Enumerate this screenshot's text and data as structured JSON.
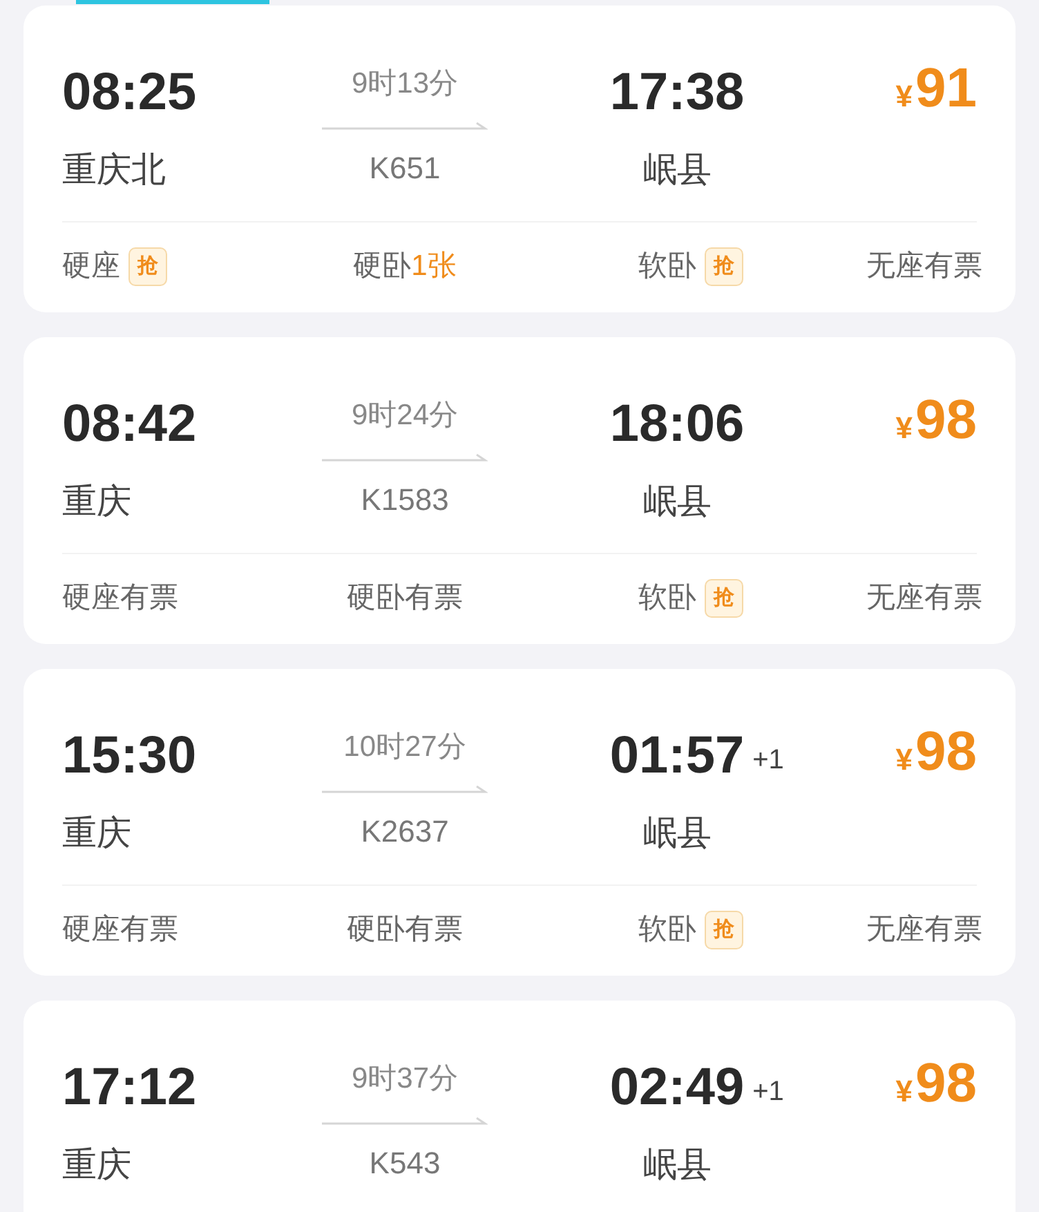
{
  "trains": [
    {
      "depart_time": "08:25",
      "depart_station": "重庆北",
      "duration": "9时13分",
      "train_no": "K651",
      "arrive_time": "17:38",
      "arrive_station": "岷县",
      "currency": "¥",
      "price": "91",
      "seats": [
        {
          "label": "硬座",
          "badge": "抢"
        },
        {
          "label": "硬卧",
          "status": "1张",
          "highlight": true
        },
        {
          "label": "软卧",
          "badge": "抢"
        },
        {
          "label": "无座",
          "status": "有票",
          "highlight": false
        }
      ]
    },
    {
      "depart_time": "08:42",
      "depart_station": "重庆",
      "duration": "9时24分",
      "train_no": "K1583",
      "arrive_time": "18:06",
      "arrive_station": "岷县",
      "currency": "¥",
      "price": "98",
      "seats": [
        {
          "label": "硬座",
          "status": "有票",
          "highlight": false
        },
        {
          "label": "硬卧",
          "status": "有票",
          "highlight": false
        },
        {
          "label": "软卧",
          "badge": "抢"
        },
        {
          "label": "无座",
          "status": "有票",
          "highlight": false
        }
      ]
    },
    {
      "depart_time": "15:30",
      "depart_station": "重庆",
      "duration": "10时27分",
      "train_no": "K2637",
      "arrive_time": "01:57",
      "day_offset": "+1",
      "arrive_station": "岷县",
      "currency": "¥",
      "price": "98",
      "seats": [
        {
          "label": "硬座",
          "status": "有票",
          "highlight": false
        },
        {
          "label": "硬卧",
          "status": "有票",
          "highlight": false
        },
        {
          "label": "软卧",
          "badge": "抢"
        },
        {
          "label": "无座",
          "status": "有票",
          "highlight": false
        }
      ]
    },
    {
      "depart_time": "17:12",
      "depart_station": "重庆",
      "duration": "9时37分",
      "train_no": "K543",
      "arrive_time": "02:49",
      "day_offset": "+1",
      "arrive_station": "岷县",
      "currency": "¥",
      "price": "98"
    }
  ]
}
